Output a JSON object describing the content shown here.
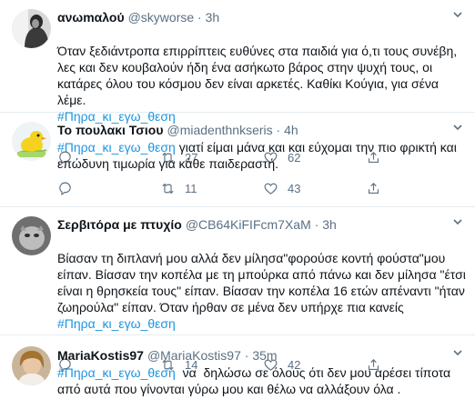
{
  "tweets": [
    {
      "name": "ανωmαλού",
      "handle": "@skyworse",
      "dot": "·",
      "time": "3h",
      "text": "Όταν ξεδιάντροπα επιρρίπτεις ευθύνες στα παιδιά για ό,τι τους συνέβη, λες και δεν κουβαλούν ήδη ένα ασήκωτο βάρος στην ψυχή τους, οι κατάρες όλου του κόσμου δεν είναι αρκετές. Καθίκι Κούγια, για σένα λέμε.",
      "hashtag": "#Πηρα_κι_εγω_θεση",
      "after_hashtag": "",
      "replies": "",
      "retweets": "27",
      "likes": "62"
    },
    {
      "name": "Το πουλακι Τσιου",
      "handle": "@miadenthnkseris",
      "dot": "·",
      "time": "4h",
      "text": "",
      "hashtag": "#Πηρα_κι_εγω_θεση",
      "after_hashtag": " γιατί είμαι μάνα και και εύχομαι την πιο φρικτή και επώδυνη τιμωρία για κάθε παιδεραστή.",
      "replies": "",
      "retweets": "11",
      "likes": "43"
    },
    {
      "name": "Σερβιτόρα με πτυχίο",
      "handle": "@CB64KiFIFcm7XaM",
      "dot": "·",
      "time": "3h",
      "text": "Βίασαν τη διπλανή μου αλλά δεν μίλησα\"φορούσε κοντή φούστα\"μου είπαν. Βίασαν την κοπέλα με τη μπούρκα από πάνω και δεν μίλησα \"έτσι είναι η θρησκεία τους\" είπαν. Βίασαν την κοπέλα 16 ετών απέναντι \"ήταν ζωηρούλα\" είπαν. Όταν ήρθαν σε μένα δεν υπήρχε πια κανείς",
      "hashtag": "#Πηρα_κι_εγω_θεση",
      "after_hashtag": "",
      "replies": "",
      "retweets": "14",
      "likes": "42"
    },
    {
      "name": "MariaKostis97",
      "handle": "@MariaKostis97",
      "dot": "·",
      "time": "35m",
      "text": "",
      "hashtag": "#Πηρα_κι_εγω_θεση",
      "after_hashtag": "  να  δηλώσω σε όλους ότι δεν μου αρέσει τίποτα από αυτά που γίνονται γύρω μου και θέλω να αλλάξουν όλα .",
      "replies": "",
      "retweets": "",
      "likes": ""
    }
  ],
  "icons": {
    "reply": "reply-icon",
    "retweet": "retweet-icon",
    "like": "heart-icon",
    "share": "share-icon",
    "caret": "chevron-down-icon"
  },
  "colors": {
    "hashtag": "#1b95e0",
    "secondary": "#5b7083",
    "divider": "#e6ecf0"
  }
}
